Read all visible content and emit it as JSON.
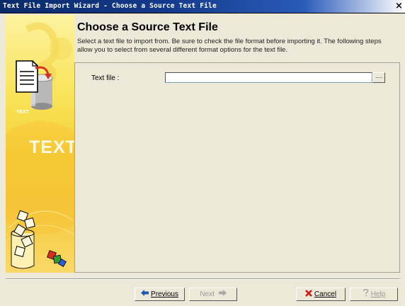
{
  "window": {
    "title": "Text File Import Wizard - Choose a Source Text File",
    "close_glyph": "×"
  },
  "header": {
    "title": "Choose a Source Text File",
    "description": "Select a text file to import from. Be sure to check the file format before importing it. The following steps allow you to select from several different format options for the text file."
  },
  "banner": {
    "big_text": "TEXT",
    "small_text": "TEXT"
  },
  "form": {
    "text_file_label": "Text file :",
    "text_file_value": "",
    "browse_label": "...."
  },
  "buttons": {
    "previous": "Previous",
    "next": "Next",
    "cancel": "Cancel",
    "help": "Help"
  },
  "icons": {
    "previous": "left-arrow-icon",
    "next": "right-arrow-icon",
    "cancel": "cancel-x-icon",
    "help": "help-icon"
  },
  "colors": {
    "cancel_icon": "#d01818",
    "arrow_icon": "#1a57b8",
    "banner_yellow": "#f5cf35"
  }
}
